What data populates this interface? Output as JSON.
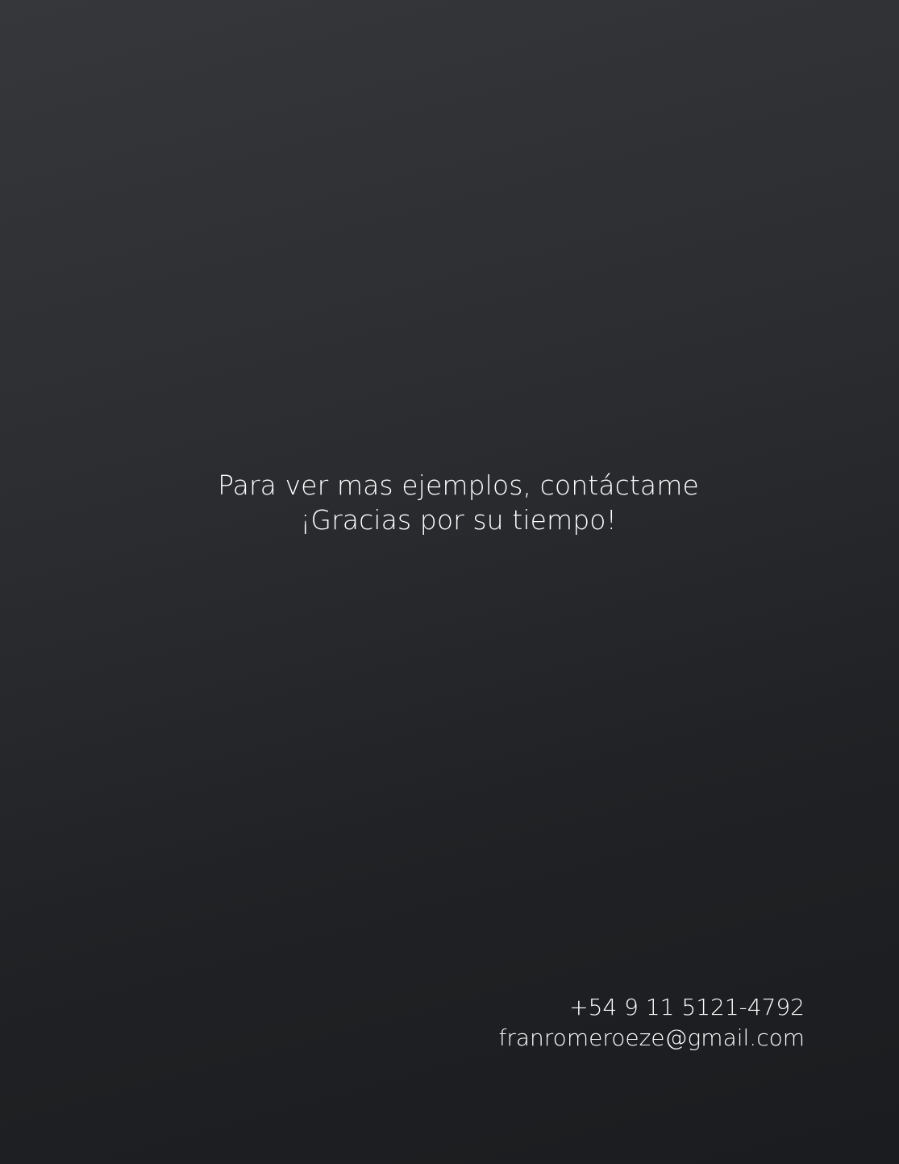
{
  "message": {
    "line1": "Para ver mas ejemplos, contáctame",
    "line2": "¡Gracias por su tiempo!"
  },
  "contact": {
    "phone": "+54 9 11 5121-4792",
    "email": "franromeroeze@gmail.com"
  },
  "colors": {
    "background_top": "#35373b",
    "background_bottom": "#1a1c1f",
    "text": "#ffffff"
  }
}
